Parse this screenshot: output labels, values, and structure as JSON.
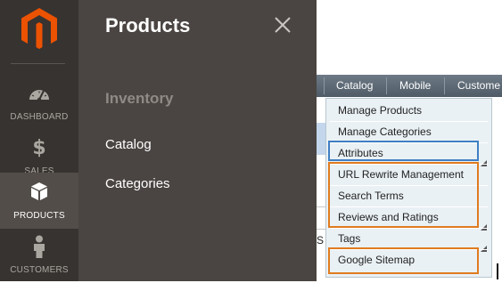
{
  "rail": {
    "items": [
      {
        "label": "DASHBOARD",
        "icon": "dashboard-icon"
      },
      {
        "label": "SALES",
        "icon": "dollar-icon"
      },
      {
        "label": "PRODUCTS",
        "icon": "box-icon",
        "active": true
      },
      {
        "label": "CUSTOMERS",
        "icon": "person-icon"
      }
    ],
    "logo": "magento-logo"
  },
  "flyout": {
    "title": "Products",
    "section": "Inventory",
    "links": [
      "Catalog",
      "Categories"
    ],
    "close_icon": "close-icon"
  },
  "legacy_menu": {
    "tabs": [
      "Catalog",
      "Mobile",
      "Custome"
    ],
    "items": [
      "Manage Products",
      "Manage Categories",
      "Attributes",
      "URL Rewrite Management",
      "Search Terms",
      "Reviews and Ratings",
      "Tags",
      "Google Sitemap"
    ],
    "background_letter": "S"
  },
  "colors": {
    "rail_bg": "#373330",
    "flyout_bg": "#4a4542",
    "active_item_bg": "#524d49",
    "logo_orange": "#eb5202",
    "highlight_blue": "#3f7fc3",
    "highlight_orange": "#e07b1f",
    "menu_bar": "#5d6974"
  }
}
